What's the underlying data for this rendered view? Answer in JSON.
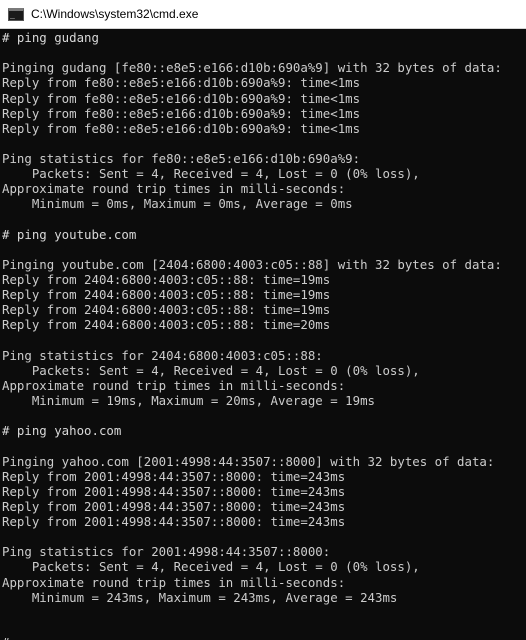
{
  "window": {
    "title": "C:\\Windows\\system32\\cmd.exe",
    "icon": "cmd-icon",
    "colors": {
      "background": "#0c0c0c",
      "text": "#cccccc",
      "titlebar": "#ffffff"
    }
  },
  "console": {
    "lines": [
      "# ping gudang",
      "",
      "Pinging gudang [fe80::e8e5:e166:d10b:690a%9] with 32 bytes of data:",
      "Reply from fe80::e8e5:e166:d10b:690a%9: time<1ms",
      "Reply from fe80::e8e5:e166:d10b:690a%9: time<1ms",
      "Reply from fe80::e8e5:e166:d10b:690a%9: time<1ms",
      "Reply from fe80::e8e5:e166:d10b:690a%9: time<1ms",
      "",
      "Ping statistics for fe80::e8e5:e166:d10b:690a%9:",
      "    Packets: Sent = 4, Received = 4, Lost = 0 (0% loss),",
      "Approximate round trip times in milli-seconds:",
      "    Minimum = 0ms, Maximum = 0ms, Average = 0ms",
      "",
      "# ping youtube.com",
      "",
      "Pinging youtube.com [2404:6800:4003:c05::88] with 32 bytes of data:",
      "Reply from 2404:6800:4003:c05::88: time=19ms",
      "Reply from 2404:6800:4003:c05::88: time=19ms",
      "Reply from 2404:6800:4003:c05::88: time=19ms",
      "Reply from 2404:6800:4003:c05::88: time=20ms",
      "",
      "Ping statistics for 2404:6800:4003:c05::88:",
      "    Packets: Sent = 4, Received = 4, Lost = 0 (0% loss),",
      "Approximate round trip times in milli-seconds:",
      "    Minimum = 19ms, Maximum = 20ms, Average = 19ms",
      "",
      "# ping yahoo.com",
      "",
      "Pinging yahoo.com [2001:4998:44:3507::8000] with 32 bytes of data:",
      "Reply from 2001:4998:44:3507::8000: time=243ms",
      "Reply from 2001:4998:44:3507::8000: time=243ms",
      "Reply from 2001:4998:44:3507::8000: time=243ms",
      "Reply from 2001:4998:44:3507::8000: time=243ms",
      "",
      "Ping statistics for 2001:4998:44:3507::8000:",
      "    Packets: Sent = 4, Received = 4, Lost = 0 (0% loss),",
      "Approximate round trip times in milli-seconds:",
      "    Minimum = 243ms, Maximum = 243ms, Average = 243ms",
      "",
      "",
      "#"
    ]
  }
}
